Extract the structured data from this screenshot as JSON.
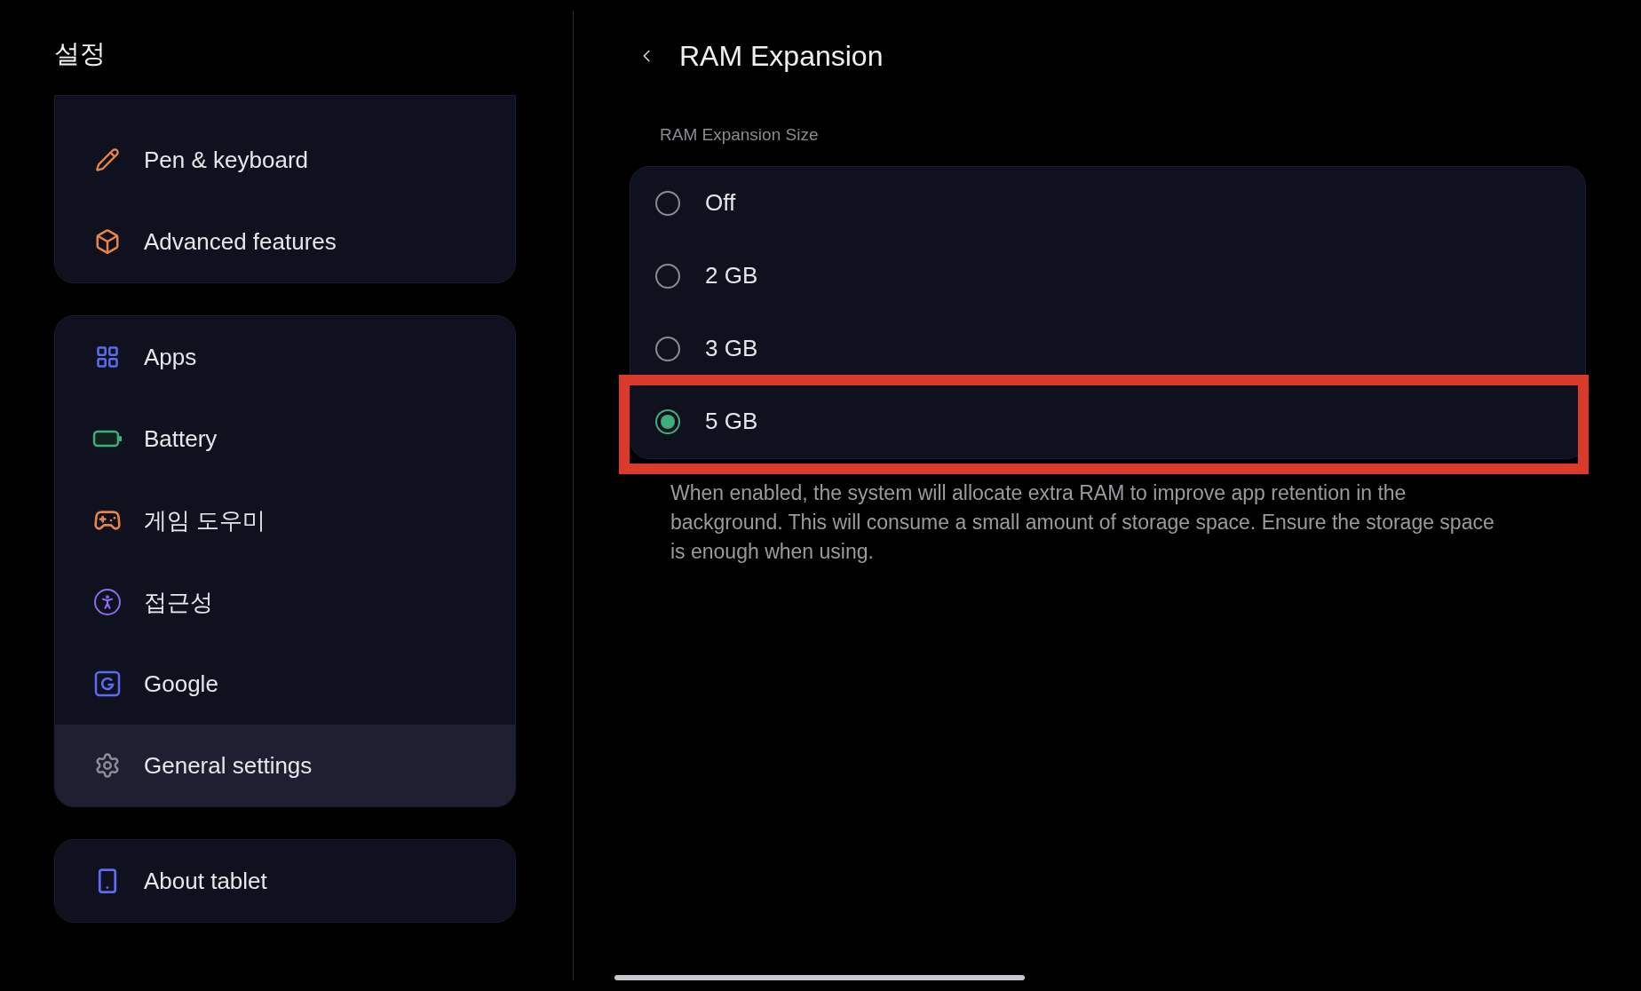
{
  "sidebar": {
    "title": "설정",
    "groups": [
      {
        "items": [
          {
            "label": "Pen & keyboard",
            "selected": false
          },
          {
            "label": "Advanced features",
            "selected": false
          }
        ]
      },
      {
        "items": [
          {
            "label": "Apps",
            "selected": false
          },
          {
            "label": "Battery",
            "selected": false
          },
          {
            "label": "게임 도우미",
            "selected": false
          },
          {
            "label": "접근성",
            "selected": false
          },
          {
            "label": "Google",
            "selected": false
          },
          {
            "label": "General settings",
            "selected": true
          }
        ]
      },
      {
        "items": [
          {
            "label": "About tablet",
            "selected": false
          }
        ]
      }
    ]
  },
  "detail": {
    "title": "RAM Expansion",
    "section_label": "RAM Expansion Size",
    "options": [
      {
        "label": "Off",
        "selected": false,
        "highlighted": false
      },
      {
        "label": "2 GB",
        "selected": false,
        "highlighted": false
      },
      {
        "label": "3 GB",
        "selected": false,
        "highlighted": false
      },
      {
        "label": "5 GB",
        "selected": true,
        "highlighted": true
      }
    ],
    "description": "When enabled, the system will allocate extra RAM to improve app retention in the background. This will consume a small amount of storage space. Ensure the storage space is enough when using."
  }
}
